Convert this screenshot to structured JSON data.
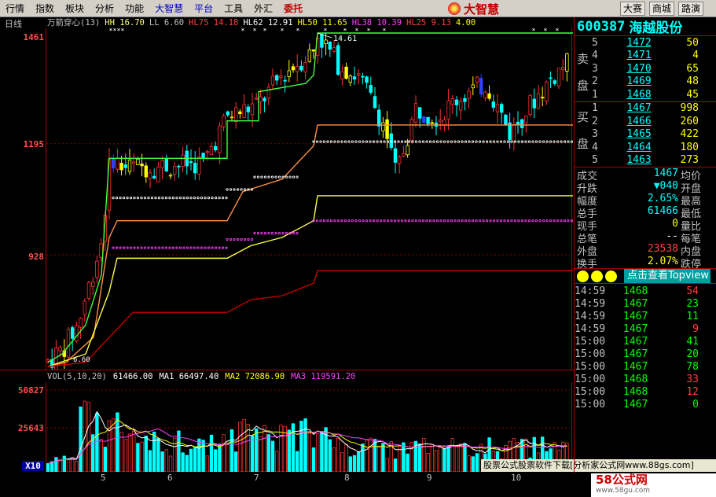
{
  "menu": {
    "items": [
      "行情",
      "指数",
      "板块",
      "分析",
      "功能",
      "大智慧",
      "平台",
      "工具",
      "外汇",
      "委托"
    ],
    "logo": "大智慧",
    "right_buttons": [
      "大赛",
      "商城",
      "路演"
    ]
  },
  "period_label": "日线",
  "indicator_header": {
    "name": "万箭穿心(13)",
    "params": [
      {
        "k": "HH",
        "v": "16.70",
        "color": "#ffff80"
      },
      {
        "k": "LL",
        "v": "6.60",
        "color": "#c0c0c0"
      },
      {
        "k": "HL75",
        "v": "14.18",
        "color": "#ff4040"
      },
      {
        "k": "HL62",
        "v": "12.91",
        "color": "#ffffff"
      },
      {
        "k": "HL50",
        "v": "11.65",
        "color": "#ffff00"
      },
      {
        "k": "HL38",
        "v": "10.39",
        "color": "#ff40ff"
      },
      {
        "k": "HL25",
        "v": "9.13",
        "color": "#ff4040"
      },
      {
        "k": "",
        "v": "4.00",
        "color": "#ffff00"
      }
    ]
  },
  "price_axis": [
    "1461",
    "1195",
    "928"
  ],
  "peak_label": "14.61",
  "low_label": "6.60",
  "volume_header": {
    "name": "VOL(5,10,20)",
    "items": [
      {
        "k": "",
        "v": "61466.00",
        "color": "#ffffff"
      },
      {
        "k": "MA1",
        "v": "66497.40",
        "color": "#ffffff"
      },
      {
        "k": "MA2",
        "v": "72086.90",
        "color": "#ffff00"
      },
      {
        "k": "MA3",
        "v": "119591.20",
        "color": "#ff40ff"
      }
    ]
  },
  "volume_axis": [
    "50827",
    "25643",
    "X10"
  ],
  "dates": [
    "5",
    "6",
    "7",
    "8",
    "9",
    "10"
  ],
  "footer_text": "股票公式股票软件下载[分析家公式网www.88gs.com]",
  "watermark": {
    "main": "58公式网",
    "sub": "www.58gu.com"
  },
  "stock": {
    "code": "600387",
    "name": "海越股份"
  },
  "sell_label": [
    "卖",
    "盘"
  ],
  "buy_label": [
    "买",
    "盘"
  ],
  "sell_orders": [
    {
      "level": "5",
      "price": "1472",
      "vol": "50"
    },
    {
      "level": "4",
      "price": "1471",
      "vol": "4"
    },
    {
      "level": "3",
      "price": "1470",
      "vol": "65"
    },
    {
      "level": "2",
      "price": "1469",
      "vol": "48"
    },
    {
      "level": "1",
      "price": "1468",
      "vol": "45"
    }
  ],
  "buy_orders": [
    {
      "level": "1",
      "price": "1467",
      "vol": "998"
    },
    {
      "level": "2",
      "price": "1466",
      "vol": "260"
    },
    {
      "level": "3",
      "price": "1465",
      "vol": "422"
    },
    {
      "level": "4",
      "price": "1464",
      "vol": "180"
    },
    {
      "level": "5",
      "price": "1463",
      "vol": "273"
    }
  ],
  "quotes": [
    {
      "label": "成交",
      "value": "1467",
      "cls": "cyn",
      "label2": "均价"
    },
    {
      "label": "升跌",
      "value": "▼040",
      "cls": "cyn",
      "label2": "开盘"
    },
    {
      "label": "幅度",
      "value": "2.65%",
      "cls": "cyn",
      "label2": "最高"
    },
    {
      "label": "总手",
      "value": "61466",
      "cls": "cyn",
      "label2": "最低"
    },
    {
      "label": "现手",
      "value": "0",
      "cls": "yel",
      "label2": "量比"
    },
    {
      "label": "总笔",
      "value": "--",
      "cls": "wht",
      "label2": "每笔"
    },
    {
      "label": "外盘",
      "value": "23538",
      "cls": "red",
      "label2": "内盘"
    },
    {
      "label": "换手",
      "value": "2.07%",
      "cls": "yel",
      "label2": "跌停"
    }
  ],
  "promo_button": "点击查看Topview",
  "ticks": [
    {
      "time": "14:59",
      "price": "1468",
      "vol": "54",
      "pc": "grn",
      "vc": "red"
    },
    {
      "time": "14:59",
      "price": "1467",
      "vol": "23",
      "pc": "grn",
      "vc": "grn"
    },
    {
      "time": "14:59",
      "price": "1467",
      "vol": "11",
      "pc": "grn",
      "vc": "grn"
    },
    {
      "time": "14:59",
      "price": "1467",
      "vol": "9",
      "pc": "grn",
      "vc": "red"
    },
    {
      "time": "15:00",
      "price": "1467",
      "vol": "41",
      "pc": "grn",
      "vc": "grn"
    },
    {
      "time": "15:00",
      "price": "1467",
      "vol": "20",
      "pc": "grn",
      "vc": "grn"
    },
    {
      "time": "15:00",
      "price": "1467",
      "vol": "78",
      "pc": "grn",
      "vc": "grn"
    },
    {
      "time": "15:00",
      "price": "1468",
      "vol": "33",
      "pc": "grn",
      "vc": "red"
    },
    {
      "time": "15:00",
      "price": "1468",
      "vol": "12",
      "pc": "grn",
      "vc": "red"
    },
    {
      "time": "15:00",
      "price": "1467",
      "vol": "0",
      "pc": "grn",
      "vc": "grn"
    }
  ]
}
